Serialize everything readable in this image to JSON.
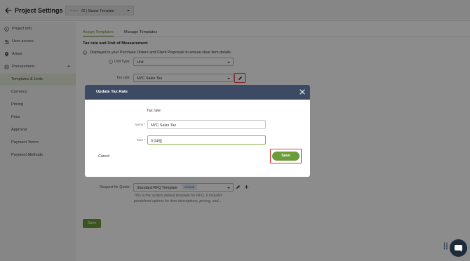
{
  "header": {
    "title": "Project Settings",
    "project_label": "Project",
    "project_value": "02 | Master Template"
  },
  "sidebar": {
    "items": [
      {
        "label": "Project info",
        "icon": "info-icon"
      },
      {
        "label": "User access",
        "icon": "users-icon"
      },
      {
        "label": "Areas",
        "icon": "location-pin-icon"
      },
      {
        "label": "Procurement",
        "icon": "cart-icon"
      },
      {
        "label": "Templates & Units"
      },
      {
        "label": "Currency"
      },
      {
        "label": "Pricing"
      },
      {
        "label": "Fees"
      },
      {
        "label": "Approval"
      },
      {
        "label": "Payment Terms"
      },
      {
        "label": "Payment Methods"
      }
    ],
    "active_item": "Templates & Units"
  },
  "tabs": [
    {
      "label": "Assign Templates",
      "active": true
    },
    {
      "label": "Manage Templates",
      "active": false
    }
  ],
  "section": {
    "title": "Tax rate and Unit of Measurement",
    "info_text": "Displayed in your Purchase Orders and Client Proposals to ensure clear item details.",
    "unit_type_label": "Unit Type:",
    "unit_type_value": "Unit",
    "tax_rate_label": "Tax rate:",
    "tax_rate_value": "NYC Sales Tax"
  },
  "rfq": {
    "label": "Request for Quote:",
    "value": "Standard RFQ Template",
    "badge": "Default",
    "note": "This is the system default template for RFQ. It includes predefined options for item descriptions, pricing, and..."
  },
  "main_save_label": "Save",
  "modal": {
    "title": "Update Tax Rate",
    "subtitle": "Tax rate",
    "name_label": "Name",
    "name_value": "NYC Sales Tax",
    "rate_label": "Rate",
    "rate_value": "0.045",
    "required_mark": "*",
    "cancel_label": "Cancel",
    "save_label": "Save"
  },
  "colors": {
    "accent_green": "#6a9c39",
    "modal_header": "#3d4a64",
    "highlight_red": "#e23b3b",
    "chat_bubble": "#1d2b3a"
  }
}
